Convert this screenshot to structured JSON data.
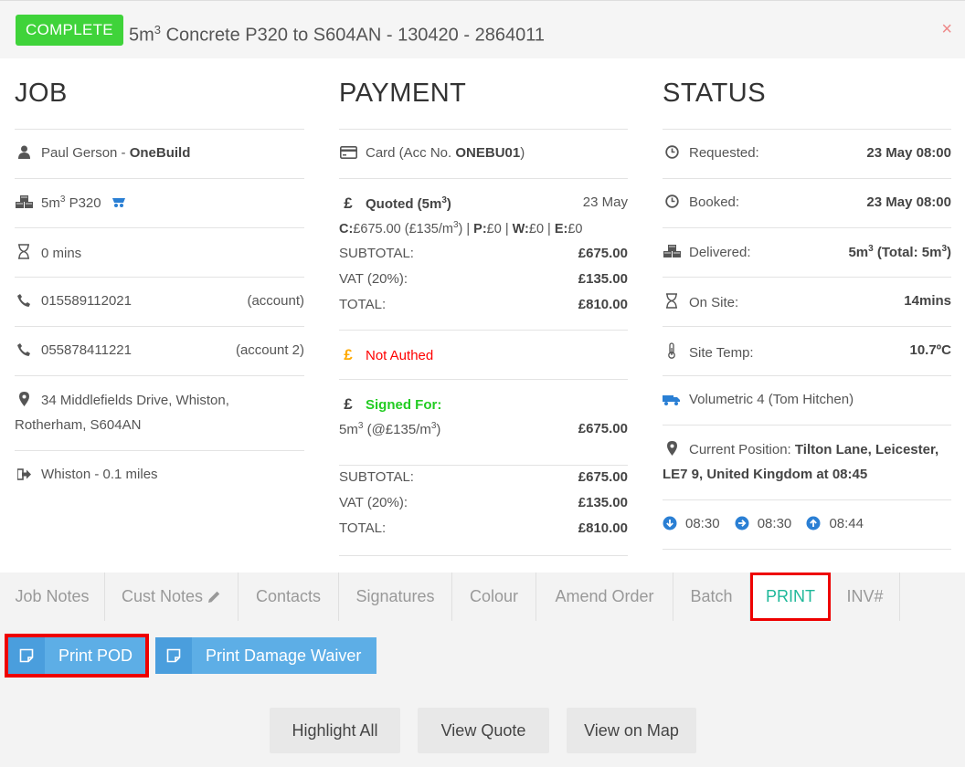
{
  "header": {
    "status_badge": "COMPLETE",
    "title_pre": "5m",
    "title_sup": "3",
    "title_post": " Concrete P320 to S604AN - 130420 - 2864011",
    "close": "×"
  },
  "job": {
    "title": "JOB",
    "customer_name": "Paul Gerson - ",
    "customer_company": "OneBuild",
    "product_pre": "5m",
    "product_sup": "3",
    "product_post": " P320",
    "duration": "0 mins",
    "phone1": "015589112021",
    "phone1_label": "(account)",
    "phone2": "055878411221",
    "phone2_label": "(account 2)",
    "address_line1": "34 Middlefields Drive, Whiston,",
    "address_line2": "Rotherham, S604AN",
    "distance": "Whiston - 0.1 miles"
  },
  "payment": {
    "title": "PAYMENT",
    "card_pre": "Card (Acc No. ",
    "card_acc": "ONEBU01",
    "card_post": ")",
    "currency_symbol": "£",
    "quoted_pre": "Quoted (5m",
    "quoted_sup": "3",
    "quoted_post": ")",
    "quoted_date": "23 May",
    "breakdown_c_label": "C:",
    "breakdown_c_value": "£675.00 (£135/m",
    "breakdown_c_sup": "3",
    "breakdown_c_tail": ") | ",
    "breakdown_p_label": "P:",
    "breakdown_p_value": "£0 | ",
    "breakdown_w_label": "W:",
    "breakdown_w_value": "£0 | ",
    "breakdown_e_label": "E:",
    "breakdown_e_value": "£0",
    "subtotal_label": "SUBTOTAL:",
    "subtotal_value": "£675.00",
    "vat_label": "VAT (20%):",
    "vat_value": "£135.00",
    "total_label": "TOTAL:",
    "total_value": "£810.00",
    "not_authed": "Not Authed",
    "signed_for": "Signed For:",
    "signed_qty_pre": "5m",
    "signed_qty_sup": "3",
    "signed_qty_mid": " (@£135/m",
    "signed_qty_sup2": "3",
    "signed_qty_post": ")",
    "signed_value": "£675.00",
    "subtotal2_label": "SUBTOTAL:",
    "subtotal2_value": "£675.00",
    "vat2_label": "VAT (20%):",
    "vat2_value": "£135.00",
    "total2_label": "TOTAL:",
    "total2_value": "£810.00"
  },
  "status": {
    "title": "STATUS",
    "requested_label": "Requested:",
    "requested_value": "23 May 08:00",
    "booked_label": "Booked:",
    "booked_value": "23 May 08:00",
    "delivered_label": "Delivered:",
    "delivered_pre": "5m",
    "delivered_sup": "3",
    "delivered_mid": " (Total: 5m",
    "delivered_sup2": "3",
    "delivered_post": ")",
    "onsite_label": "On Site:",
    "onsite_value": "14mins",
    "temp_label": "Site Temp:",
    "temp_value": "10.7ºC",
    "vehicle": "Volumetric 4 (Tom Hitchen)",
    "position_label": "Current Position: ",
    "position_line1": "Tilton Lane, Leicester,",
    "position_line2": "LE7 9, United Kingdom at 08:45",
    "time1": "08:30",
    "time2": "08:30",
    "time3": "08:44"
  },
  "tabs": [
    {
      "label": "Job Notes"
    },
    {
      "label": "Cust Notes"
    },
    {
      "label": "Contacts"
    },
    {
      "label": "Signatures"
    },
    {
      "label": "Colour"
    },
    {
      "label": "Amend Order"
    },
    {
      "label": "Batch"
    },
    {
      "label": "PRINT"
    },
    {
      "label": "INV#"
    }
  ],
  "print": {
    "print_pod": "Print POD",
    "print_damage_waiver": "Print Damage Waiver"
  },
  "footer": {
    "highlight_all": "Highlight All",
    "view_quote": "View Quote",
    "view_on_map": "View on Map"
  },
  "colors": {
    "complete_badge": "#3fd33a",
    "active_tab": "#1fb89a",
    "highlight_outline": "#ee0000",
    "print_button": "#5daee6",
    "not_authed": "#ff0000",
    "signed_for": "#22cc22"
  }
}
